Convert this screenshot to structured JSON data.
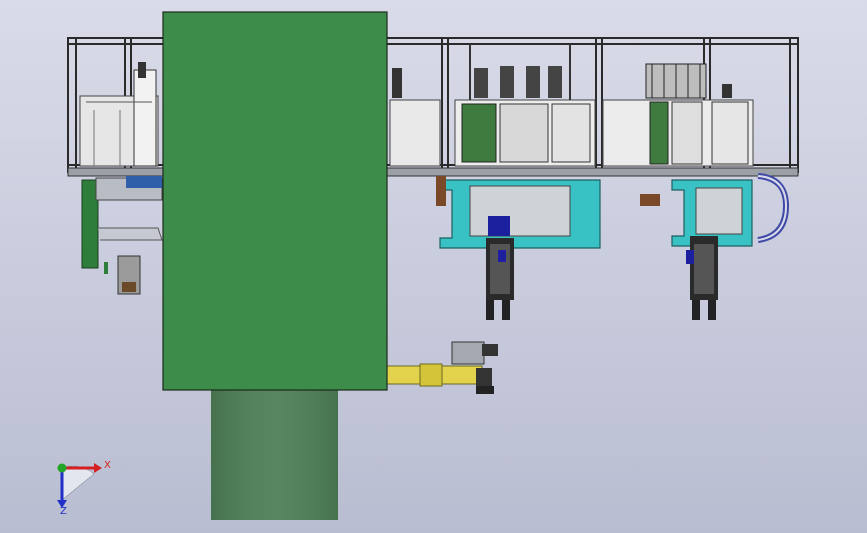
{
  "viewport": {
    "background_top": "#d9dbe8",
    "background_bottom": "#b9bdd1"
  },
  "model": {
    "body_color": "#3e8c49",
    "column_color": "#4f7d57",
    "teal_color": "#38c2c4",
    "cylinder_color": "#1c1f9e",
    "slide_color": "#e2d24c",
    "frame_color": "#2a2a2a"
  },
  "triad": {
    "x_label": "X",
    "z_label": "Z",
    "x_color": "#d42020",
    "z_color": "#1f2fc8",
    "y_color": "#23a52a"
  }
}
